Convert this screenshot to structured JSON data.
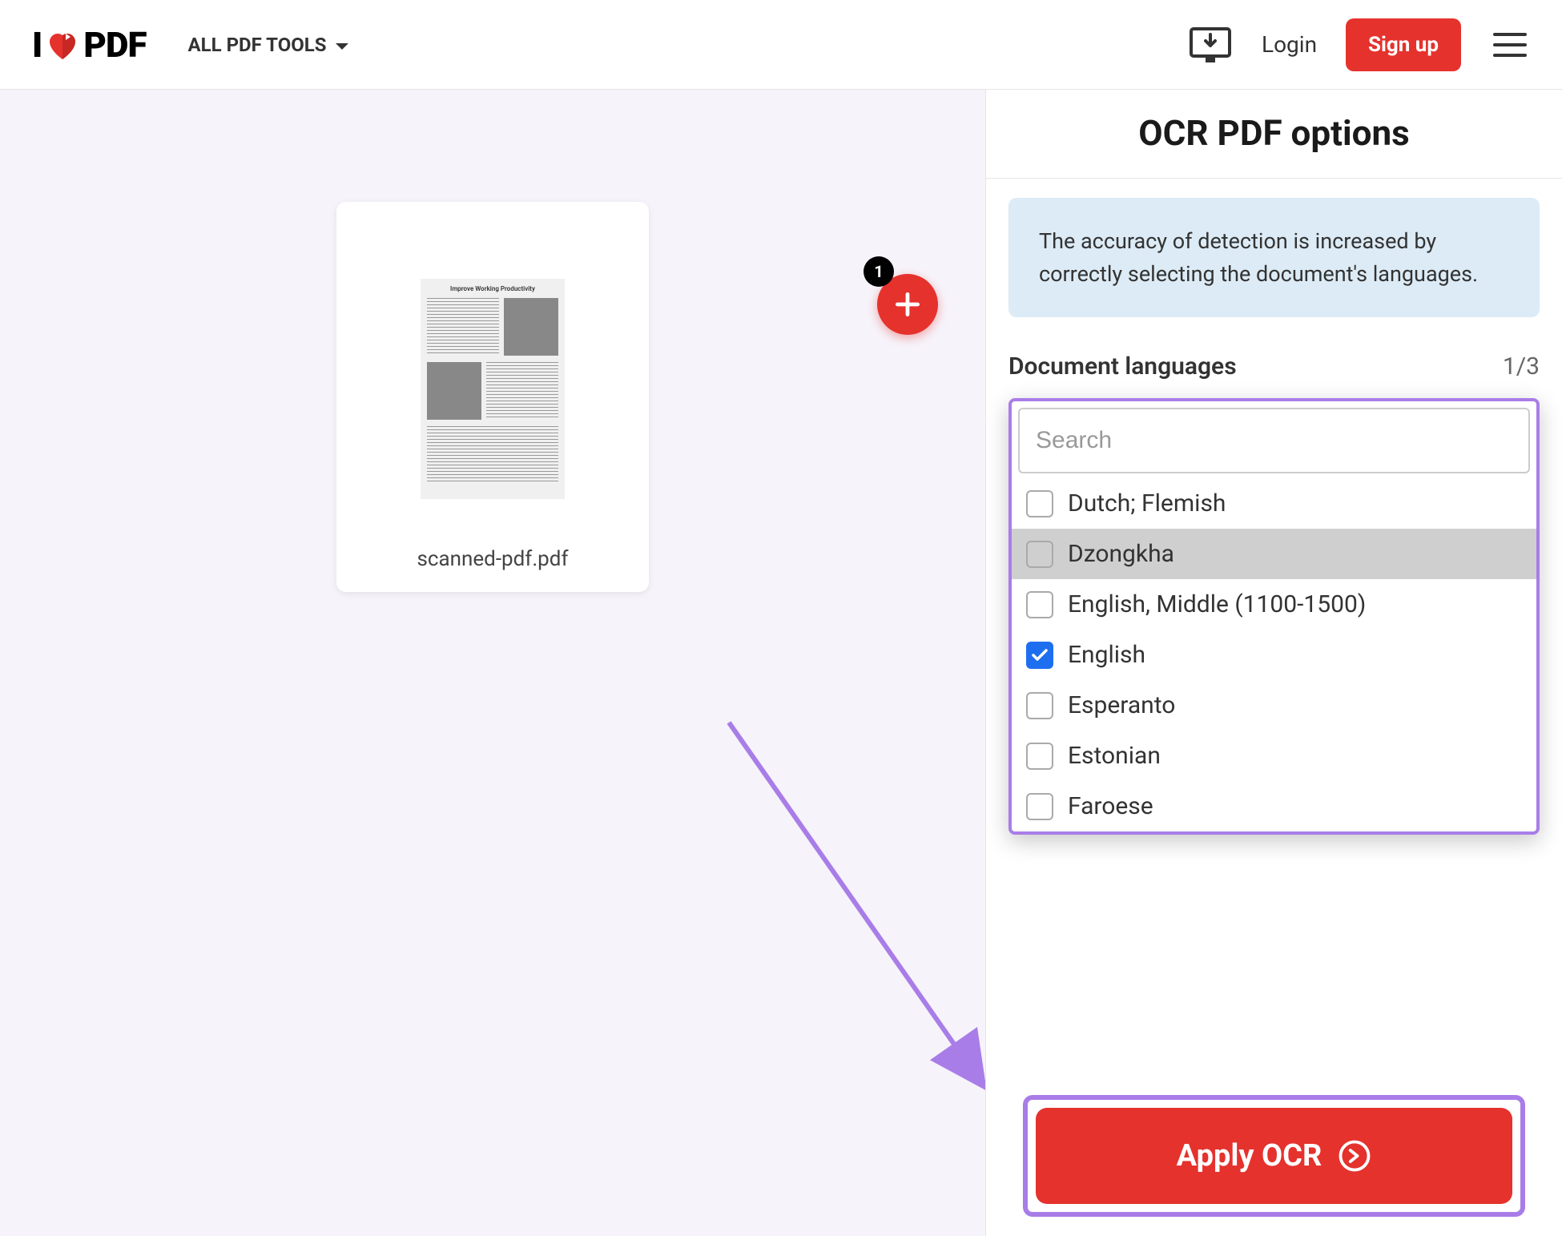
{
  "header": {
    "logo_prefix": "I",
    "logo_suffix": "PDF",
    "tools_label": "ALL PDF TOOLS",
    "login_label": "Login",
    "signup_label": "Sign up"
  },
  "canvas": {
    "file_name": "scanned-pdf.pdf",
    "badge_count": "1",
    "thumb_title": "Improve Working Productivity"
  },
  "sidebar": {
    "title": "OCR PDF options",
    "info_text": "The accuracy of detection is increased by correctly selecting the document's languages.",
    "lang_label": "Document languages",
    "lang_count": "1/3",
    "search_placeholder": "Search",
    "languages": [
      {
        "label": "Dutch; Flemish",
        "checked": false,
        "highlighted": false
      },
      {
        "label": "Dzongkha",
        "checked": false,
        "highlighted": true
      },
      {
        "label": "English, Middle (1100-1500)",
        "checked": false,
        "highlighted": false
      },
      {
        "label": "English",
        "checked": true,
        "highlighted": false
      },
      {
        "label": "Esperanto",
        "checked": false,
        "highlighted": false
      },
      {
        "label": "Estonian",
        "checked": false,
        "highlighted": false
      },
      {
        "label": "Faroese",
        "checked": false,
        "highlighted": false
      }
    ],
    "apply_label": "Apply OCR"
  },
  "colors": {
    "accent": "#e5322d",
    "highlight_border": "#a97de8",
    "info_bg": "#dcebf5",
    "checkbox_checked": "#1e6ef0"
  }
}
